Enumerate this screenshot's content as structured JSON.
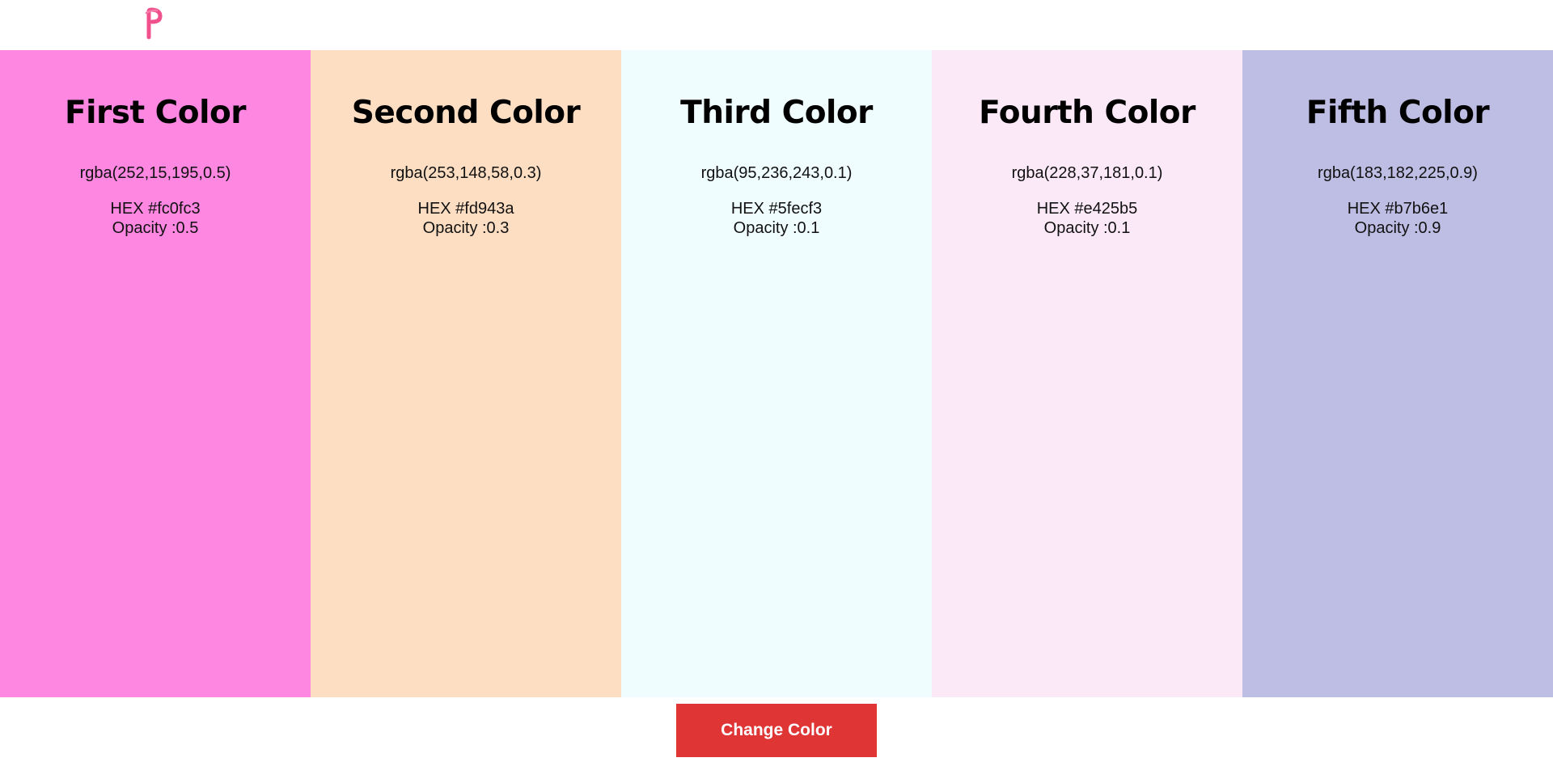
{
  "header": {
    "logo_letter": "P",
    "logo_color": "#f0508c"
  },
  "panels": [
    {
      "title": "First Color",
      "rgba": "rgba(252,15,195,0.5)",
      "hex": "HEX #fc0fc3",
      "opacity": "Opacity :0.5",
      "background": "#fd87e1"
    },
    {
      "title": "Second Color",
      "rgba": "rgba(253,148,58,0.3)",
      "hex": "HEX #fd943a",
      "opacity": "Opacity :0.3",
      "background": "#fedec3"
    },
    {
      "title": "Third Color",
      "rgba": "rgba(95,236,243,0.1)",
      "hex": "HEX #5fecf3",
      "opacity": "Opacity :0.1",
      "background": "#effdfe"
    },
    {
      "title": "Fourth Color",
      "rgba": "rgba(228,37,181,0.1)",
      "hex": "HEX #e425b5",
      "opacity": "Opacity :0.1",
      "background": "#fce9f8"
    },
    {
      "title": "Fifth Color",
      "rgba": "rgba(183,182,225,0.9)",
      "hex": "HEX #b7b6e1",
      "opacity": "Opacity :0.9",
      "background": "#bebde4"
    }
  ],
  "button": {
    "label": "Change Color",
    "color": "#e03535"
  }
}
